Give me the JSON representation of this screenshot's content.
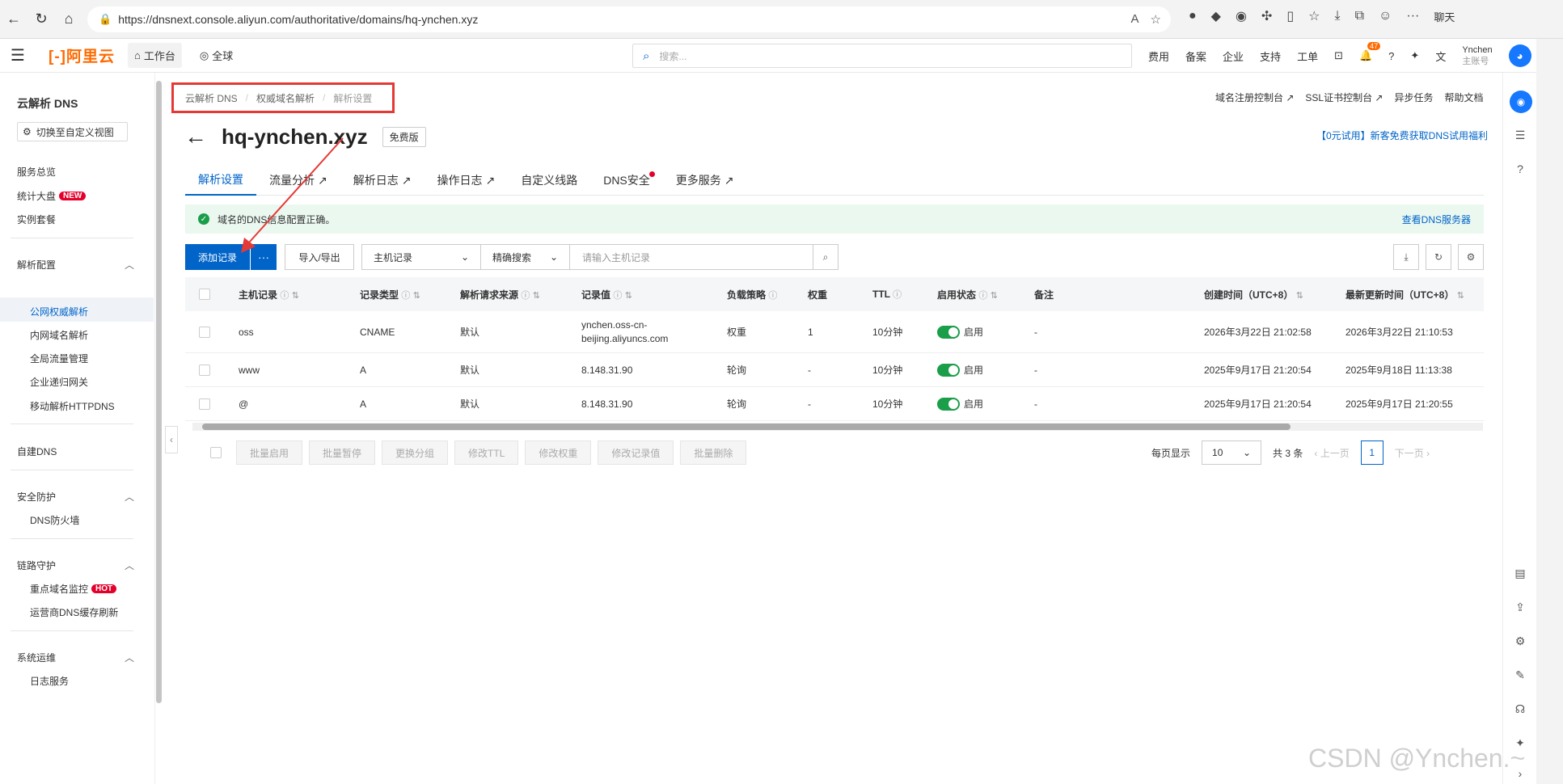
{
  "browser": {
    "url": "https://dnsnext.console.aliyun.com/authoritative/domains/hq-ynchen.xyz",
    "chat_label": "聊天"
  },
  "header": {
    "logo": "[-]阿里云",
    "workbench": "工作台",
    "global": "全球",
    "search_placeholder": "搜索...",
    "links": [
      "费用",
      "备案",
      "企业",
      "支持",
      "工单"
    ],
    "notification_count": "47",
    "user_name": "Ynchen",
    "user_role": "主账号"
  },
  "sidebar": {
    "title": "云解析 DNS",
    "switch_view": "切换至自定义视图",
    "items": [
      "服务总览",
      "统计大盘",
      "实例套餐"
    ],
    "new_tag": "NEW",
    "group_resolution": "解析配置",
    "resolution_items": [
      "公网权威解析",
      "内网域名解析",
      "全局流量管理",
      "企业递归网关",
      "移动解析HTTPDNS"
    ],
    "self_dns": "自建DNS",
    "group_security": "安全防护",
    "security_items": [
      "DNS防火墙"
    ],
    "group_link": "链路守护",
    "link_items": [
      "重点域名监控",
      "运营商DNS缓存刷新"
    ],
    "hot_tag": "HOT",
    "group_ops": "系统运维",
    "ops_items": [
      "日志服务"
    ]
  },
  "breadcrumb": [
    "云解析 DNS",
    "权威域名解析",
    "解析设置"
  ],
  "top_links": [
    "域名注册控制台",
    "SSL证书控制台",
    "异步任务",
    "帮助文档"
  ],
  "page": {
    "domain": "hq-ynchen.xyz",
    "edition": "免费版",
    "promo": "【0元试用】新客免费获取DNS试用福利"
  },
  "tabs": [
    "解析设置",
    "流量分析",
    "解析日志",
    "操作日志",
    "自定义线路",
    "DNS安全",
    "更多服务"
  ],
  "notice": {
    "text": "域名的DNS信息配置正确。",
    "link": "查看DNS服务器"
  },
  "toolbar": {
    "add": "添加记录",
    "more": "···",
    "import_export": "导入/导出",
    "field_select": "主机记录",
    "match_select": "精确搜索",
    "search_placeholder": "请输入主机记录"
  },
  "table": {
    "headers": [
      "主机记录",
      "记录类型",
      "解析请求来源",
      "记录值",
      "负载策略",
      "权重",
      "TTL",
      "启用状态",
      "备注",
      "创建时间（UTC+8）",
      "最新更新时间（UTC+8）"
    ],
    "rows": [
      {
        "host": "oss",
        "type": "CNAME",
        "source": "默认",
        "value_line1": "ynchen.oss-cn-",
        "value_line2": "beijing.aliyuncs.com",
        "policy": "权重",
        "weight": "1",
        "ttl": "10分钟",
        "status": "启用",
        "note": "-",
        "created": "2026年3月22日 21:02:58",
        "updated": "2026年3月22日 21:10:53"
      },
      {
        "host": "www",
        "type": "A",
        "source": "默认",
        "value_line1": "8.148.31.90",
        "value_line2": "",
        "policy": "轮询",
        "weight": "-",
        "ttl": "10分钟",
        "status": "启用",
        "note": "-",
        "created": "2025年9月17日 21:20:54",
        "updated": "2025年9月18日 11:13:38"
      },
      {
        "host": "@",
        "type": "A",
        "source": "默认",
        "value_line1": "8.148.31.90",
        "value_line2": "",
        "policy": "轮询",
        "weight": "-",
        "ttl": "10分钟",
        "status": "启用",
        "note": "-",
        "created": "2025年9月17日 21:20:54",
        "updated": "2025年9月17日 21:20:55"
      }
    ]
  },
  "batch": [
    "批量启用",
    "批量暂停",
    "更换分组",
    "修改TTL",
    "修改权重",
    "修改记录值",
    "批量删除"
  ],
  "pager": {
    "per_page_label": "每页显示",
    "per_page": "10",
    "total": "共 3 条",
    "prev": "上一页",
    "current": "1",
    "next": "下一页"
  },
  "watermark": "CSDN @Ynchen.~"
}
